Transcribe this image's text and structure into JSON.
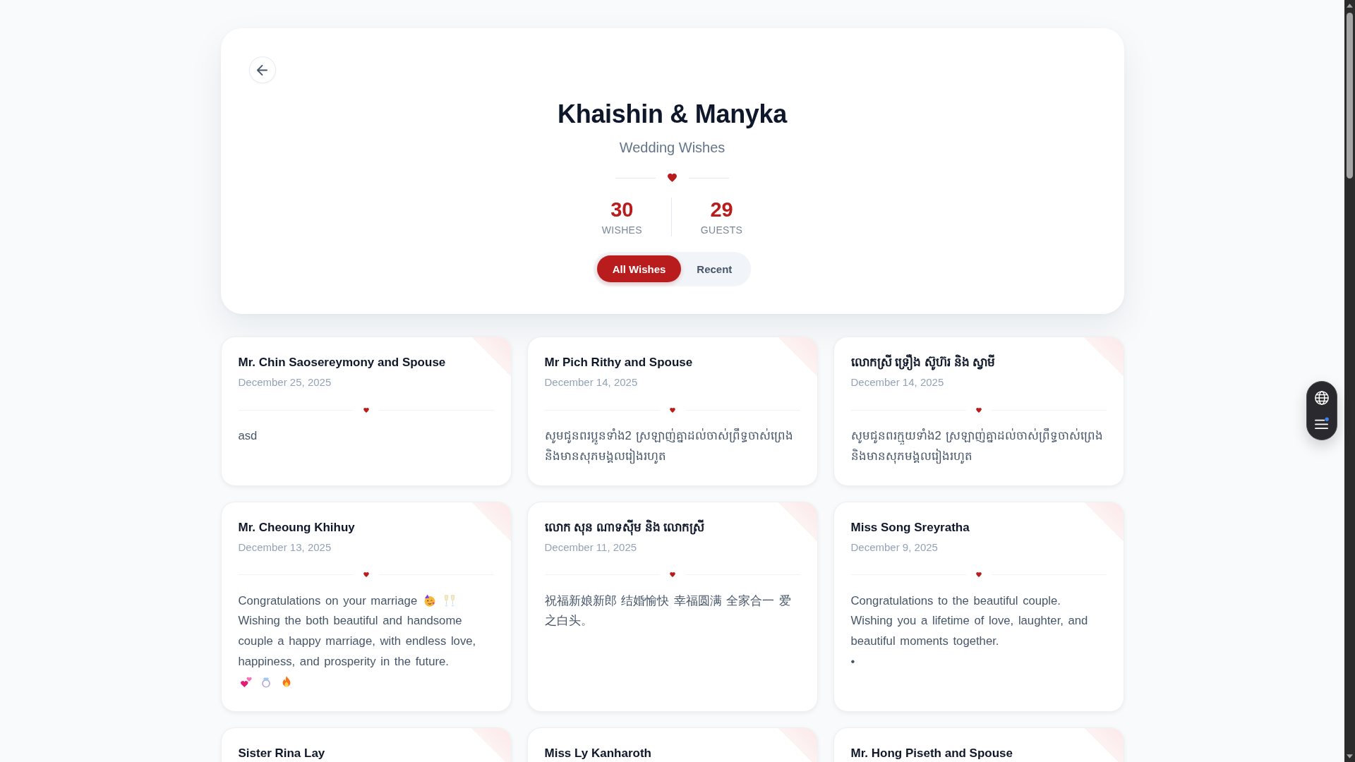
{
  "header": {
    "title": "Khaishin & Manyka",
    "subtitle": "Wedding Wishes",
    "stats": [
      {
        "value": "30",
        "label": "WISHES"
      },
      {
        "value": "29",
        "label": "GUESTS"
      }
    ]
  },
  "filter_tabs": [
    {
      "label": "All Wishes",
      "selected": true
    },
    {
      "label": "Recent",
      "selected": false
    }
  ],
  "wishes": [
    {
      "name": "Mr. Chin Saosereymony and Spouse",
      "date": "December 25, 2025",
      "message": [
        {
          "kind": "text",
          "text": "asd"
        }
      ]
    },
    {
      "name": "Mr Pich Rithy and Spouse",
      "date": "December 14, 2025",
      "message": [
        {
          "kind": "text",
          "text": "សូមជូនពរប្អូនទាំង2 ស្រឡាញ់គ្នាដល់ចាស់ព្រឹទ្ធចាស់ព្រេង និងមានសុភមង្គលរៀងរហូត"
        }
      ]
    },
    {
      "name": "លោកស្រី ទ្រឿង ស៊ូហ៊រ និង ស្វាមី",
      "date": "December 14, 2025",
      "message": [
        {
          "kind": "text",
          "text": "សូមជូនពរក្មួយទាំង2 ស្រឡាញ់គ្នាដល់ចាស់ព្រឹទ្ធចាស់ព្រេង និងមានសុភមង្គលរៀងរហូត"
        }
      ]
    },
    {
      "name": "Mr. Cheoung Khihuy",
      "date": "December 13, 2025",
      "message": [
        {
          "kind": "text",
          "text": "Congratulations on your marriage"
        },
        {
          "kind": "party"
        },
        {
          "kind": "toast"
        },
        {
          "kind": "text",
          "text": "Wishing the both beautiful and handsome couple a happy marriage, with endless love, happiness, and prosperity in the future."
        },
        {
          "kind": "hearts"
        },
        {
          "kind": "ring"
        },
        {
          "kind": "fire"
        }
      ]
    },
    {
      "name": "លោក សុន ណាទស៊ីម និង លោកស្រី",
      "date": "December 11, 2025",
      "message": [
        {
          "kind": "text",
          "text": "祝福新娘新郎 结婚愉快 幸福圆满 全家合一 爱之白头。"
        }
      ]
    },
    {
      "name": "Miss Song Sreyratha",
      "date": "December 9, 2025",
      "message": [
        {
          "kind": "text",
          "text": "Congratulations to the beautiful couple. Wishing you a lifetime of love, laughter, and beautiful moments together.\n•"
        }
      ]
    },
    {
      "name": "Sister Rina Lay"
    },
    {
      "name": "Miss Ly Kanharoth"
    },
    {
      "name": "Mr. Hong Piseth and Spouse"
    }
  ]
}
